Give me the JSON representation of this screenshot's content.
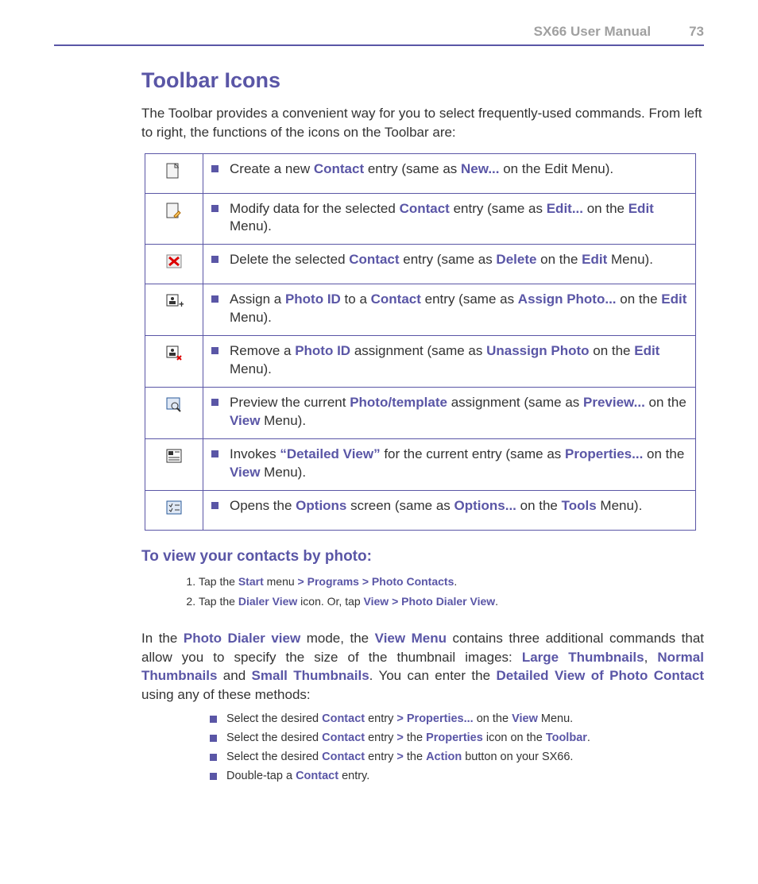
{
  "header": {
    "manual": "SX66 User Manual",
    "page": "73"
  },
  "h1": "Toolbar Icons",
  "intro": "The Toolbar provides a convenient way for you to select frequently-used commands. From left to right, the functions of the icons on the Toolbar are:",
  "rows": {
    "r0": {
      "p0": "Create a new ",
      "k0": "Contact",
      "p1": " entry (same as ",
      "k1": "New...",
      "p2": " on the Edit Menu)."
    },
    "r1": {
      "p0": "Modify data for the selected ",
      "k0": "Contact",
      "p1": " entry (same as ",
      "k1": "Edit...",
      "p2": " on the ",
      "k2": "Edit",
      "p3": " Menu)."
    },
    "r2": {
      "p0": "Delete the selected ",
      "k0": "Contact",
      "p1": " entry (same as ",
      "k1": "Delete",
      "p2": " on the ",
      "k2": "Edit",
      "p3": " Menu)."
    },
    "r3": {
      "p0": "Assign a ",
      "k0": "Photo ID",
      "p1": " to a ",
      "k1": "Contact",
      "p2": " entry (same as ",
      "k2": "Assign Photo...",
      "p3": " on the ",
      "k3": "Edit",
      "p4": " Menu)."
    },
    "r4": {
      "p0": "Remove a ",
      "k0": "Photo ID",
      "p1": " assignment (same as ",
      "k1": "Unassign Photo",
      "p2": " on the ",
      "k2": "Edit",
      "p3": " Menu)."
    },
    "r5": {
      "p0": "Preview the current ",
      "k0": "Photo/template",
      "p1": " assignment (same as ",
      "k1": "Preview...",
      "p2": " on the ",
      "k2": "View",
      "p3": " Menu)."
    },
    "r6": {
      "p0": "Invokes ",
      "k0": "“Detailed View”",
      "p1": " for the current entry (same as ",
      "k1": "Properties...",
      "p2": " on the ",
      "k2": "View",
      "p3": " Menu)."
    },
    "r7": {
      "p0": "Opens the ",
      "k0": "Options",
      "p1": " screen (same as ",
      "k1": "Options...",
      "p2": " on the ",
      "k2": "Tools",
      "p3": " Menu)."
    }
  },
  "h2": "To view your contacts by photo:",
  "steps": {
    "s0": {
      "p0": "Tap the ",
      "k0": "Start",
      "p1": " menu ",
      "k1": "> Programs > Photo Contacts",
      "p2": "."
    },
    "s1": {
      "p0": "Tap the ",
      "k0": "Dialer View",
      "p1": " icon. Or, tap ",
      "k1": "View > Photo Dialer View",
      "p2": "."
    }
  },
  "para": {
    "p0": "In the ",
    "k0": "Photo Dialer view",
    "p1": " mode, the ",
    "k1": "View Menu",
    "p2": " contains three additional commands that allow you to specify the size of the thumbnail images: ",
    "k2": "Large Thumbnails",
    "p3": ", ",
    "k3": "Normal Thumbnails",
    "p4": " and ",
    "k4": "Small Thumbnails",
    "p5": ". You can enter the ",
    "k5": "Detailed View of Photo Contact",
    "p6": " using any of these methods:"
  },
  "bullets": {
    "b0": {
      "p0": "Select the desired ",
      "k0": "Contact",
      "p1": " entry ",
      "k1": "> Properties...",
      "p2": " on the ",
      "k2": "View",
      "p3": " Menu."
    },
    "b1": {
      "p0": "Select the desired ",
      "k0": "Contact",
      "p1": " entry ",
      "k1": ">",
      "p2": " the ",
      "k2": "Properties",
      "p3": " icon on the ",
      "k3": "Toolbar",
      "p4": "."
    },
    "b2": {
      "p0": "Select the desired ",
      "k0": "Contact",
      "p1": " entry ",
      "k1": ">",
      "p2": " the ",
      "k2": "Action",
      "p3": " button on your SX66."
    },
    "b3": {
      "p0": "Double-tap a ",
      "k0": "Contact",
      "p1": " entry."
    }
  }
}
